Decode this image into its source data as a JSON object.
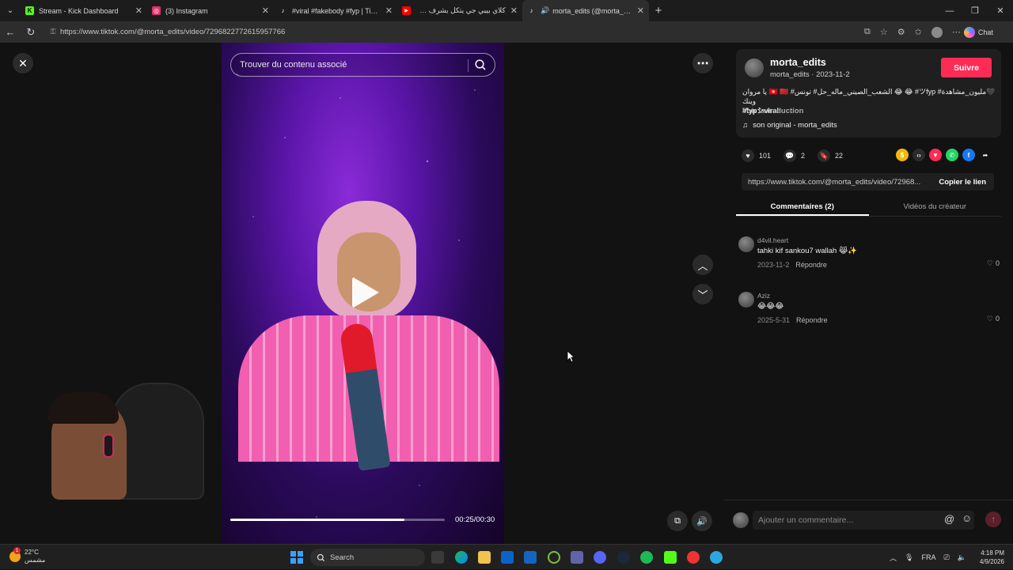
{
  "browser": {
    "tabs": [
      {
        "title": "Stream - Kick Dashboard",
        "favicon": "kick-icon",
        "color": "#53fc18",
        "glyph": "K"
      },
      {
        "title": "(3) Instagram",
        "favicon": "instagram-icon",
        "color": "#e1306c",
        "glyph": "◎"
      },
      {
        "title": "#viral #fakebody #fyp | TikTok",
        "favicon": "tiktok-icon",
        "color": "#1c1c1c",
        "glyph": "♪"
      },
      {
        "title": "كلاي بيبي جي يتكل بشرف جلال بريك",
        "favicon": "youtube-icon",
        "color": "#ff0000",
        "glyph": "▶"
      },
      {
        "title": "morta_edits (@morta_edits) |",
        "favicon": "tiktok-icon",
        "color": "#1c1c1c",
        "glyph": "♪"
      }
    ],
    "url": "https://www.tiktok.com/@morta_edits/video/7296822772615957766",
    "chat_label": "Chat"
  },
  "player": {
    "search_placeholder": "Trouver du contenu associé",
    "time": "00:25/00:30",
    "progress": 0.81
  },
  "side": {
    "author": "morta_edits",
    "author_sub": "morta_edits · 2023-11-2",
    "follow_label": "Suivre",
    "caption_line1": "🖤مليون_مشاهدة# ツfyp# 😂 😂 الشعب_الصيني_ماله_حل# تونس# 🇹🇳 🇲🇦 يا مروان وينك",
    "caption_line2": "#fypシviral",
    "see_translation": "Voir la traduction",
    "music": "son original - morta_edits",
    "likes": "101",
    "comments": "2",
    "saves": "22",
    "link": "https://www.tiktok.com/@morta_edits/video/72968...",
    "copy_link": "Copier le lien",
    "tab_comments": "Commentaires (2)",
    "tab_videos": "Vidéos du créateur",
    "comment_list": [
      {
        "user": "d4vil.heart",
        "text": "tahki kif sankou7 wallah 😹✨",
        "date": "2023-11-2",
        "reply": "Répondre",
        "likes": "0"
      },
      {
        "user": "Aziz",
        "text": "😂😂😂",
        "date": "2025-5-31",
        "reply": "Répondre",
        "likes": "0"
      }
    ],
    "comment_placeholder": "Ajouter un commentaire..."
  },
  "taskbar": {
    "temp": "22°C",
    "weather": "مشمس",
    "weather_badge": "1",
    "search": "Search",
    "lang": "FRA",
    "time": "4:18 PM",
    "date": "4/9/2026"
  }
}
